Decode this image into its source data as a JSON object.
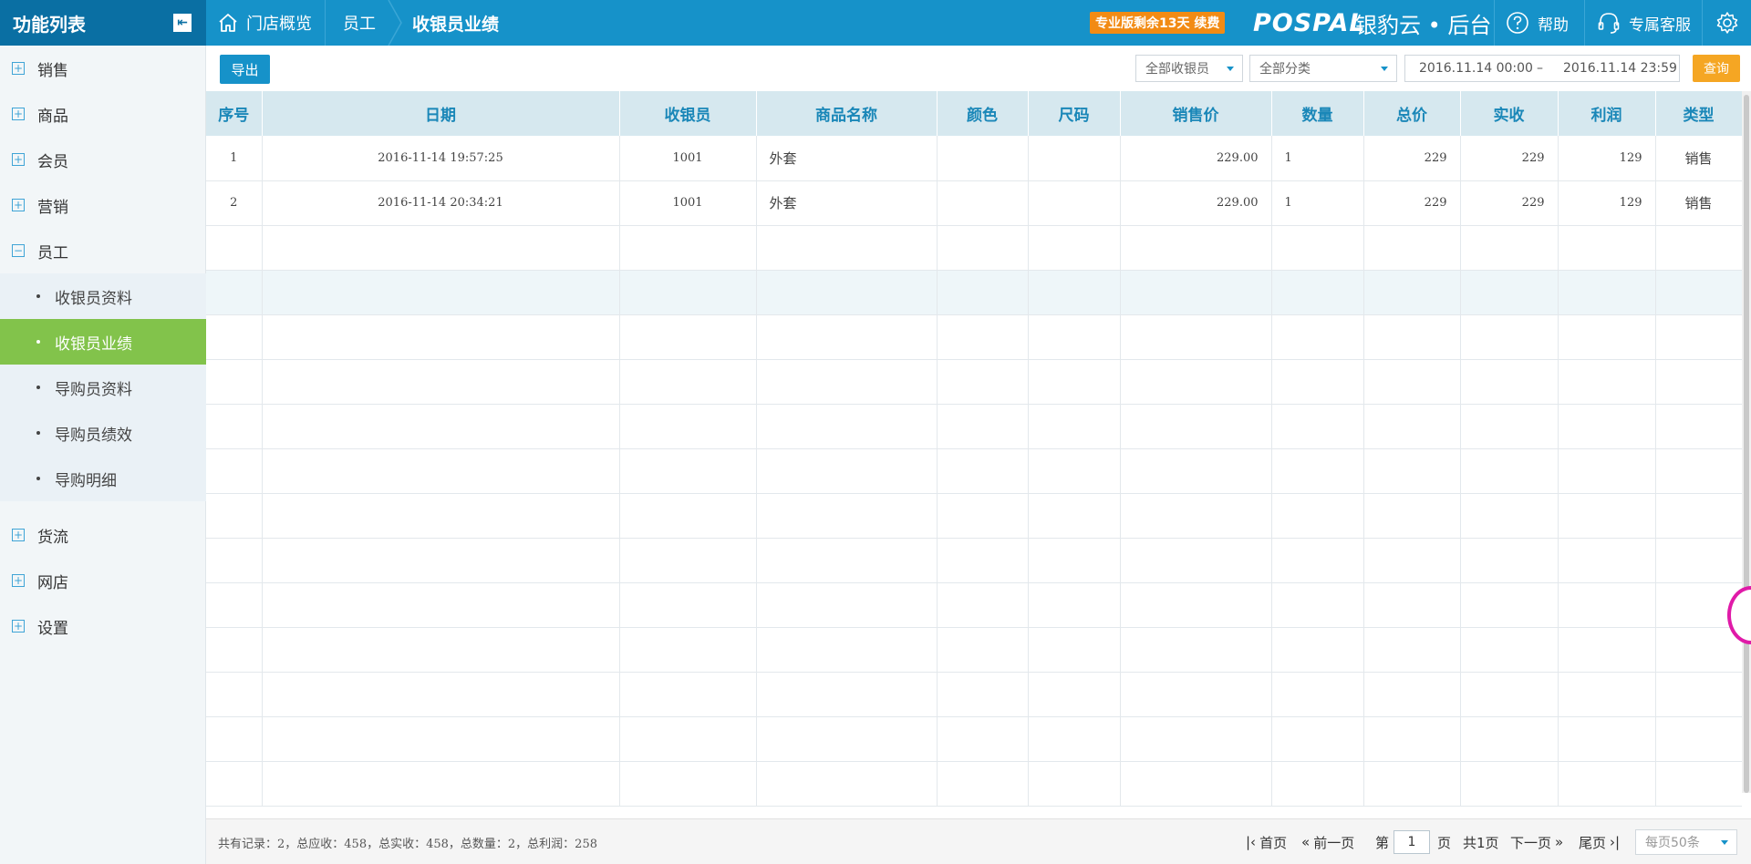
{
  "sidebar_title": "功能列表",
  "breadcrumb": {
    "home": "门店概览",
    "section": "员工",
    "current": "收银员业绩"
  },
  "trial_badge": "专业版剩余13天 续费",
  "brand": {
    "logo_text": "POSPAL",
    "product": "银豹云 • 后台"
  },
  "header_actions": {
    "help": "帮助",
    "service": "专属客服"
  },
  "sidebar": {
    "items": [
      {
        "label": "销售"
      },
      {
        "label": "商品"
      },
      {
        "label": "会员"
      },
      {
        "label": "营销"
      },
      {
        "label": "员工"
      }
    ],
    "sub_items": [
      {
        "label": "收银员资料"
      },
      {
        "label": "收银员业绩"
      },
      {
        "label": "导购员资料"
      },
      {
        "label": "导购员绩效"
      },
      {
        "label": "导购明细"
      }
    ],
    "items_after": [
      {
        "label": "货流"
      },
      {
        "label": "网店"
      },
      {
        "label": "设置"
      }
    ]
  },
  "toolbar": {
    "export": "导出",
    "cashier_filter": "全部收银员",
    "category_filter": "全部分类",
    "date_start": "2016.11.14 00:00",
    "date_sep": "–",
    "date_end": "2016.11.14 23:59",
    "query": "查询"
  },
  "table": {
    "headers": [
      "序号",
      "日期",
      "收银员",
      "商品名称",
      "颜色",
      "尺码",
      "销售价",
      "数量",
      "总价",
      "实收",
      "利润",
      "类型"
    ],
    "rows": [
      [
        "1",
        "2016-11-14 19:57:25",
        "1001",
        "外套",
        "",
        "",
        "229.00",
        "1",
        "229",
        "229",
        "129",
        "销售"
      ],
      [
        "2",
        "2016-11-14 20:34:21",
        "1001",
        "外套",
        "",
        "",
        "229.00",
        "1",
        "229",
        "229",
        "129",
        "销售"
      ]
    ]
  },
  "footer": {
    "summary": "共有记录：2，总应收：458，总实收：458，总数量：2，总利润：258",
    "first": "首页",
    "prev": "前一页",
    "page_label": "第",
    "page_value": "1",
    "page_unit": "页",
    "total_pages": "共1页",
    "next": "下一页",
    "last": "尾页",
    "page_size": "每页50条"
  }
}
